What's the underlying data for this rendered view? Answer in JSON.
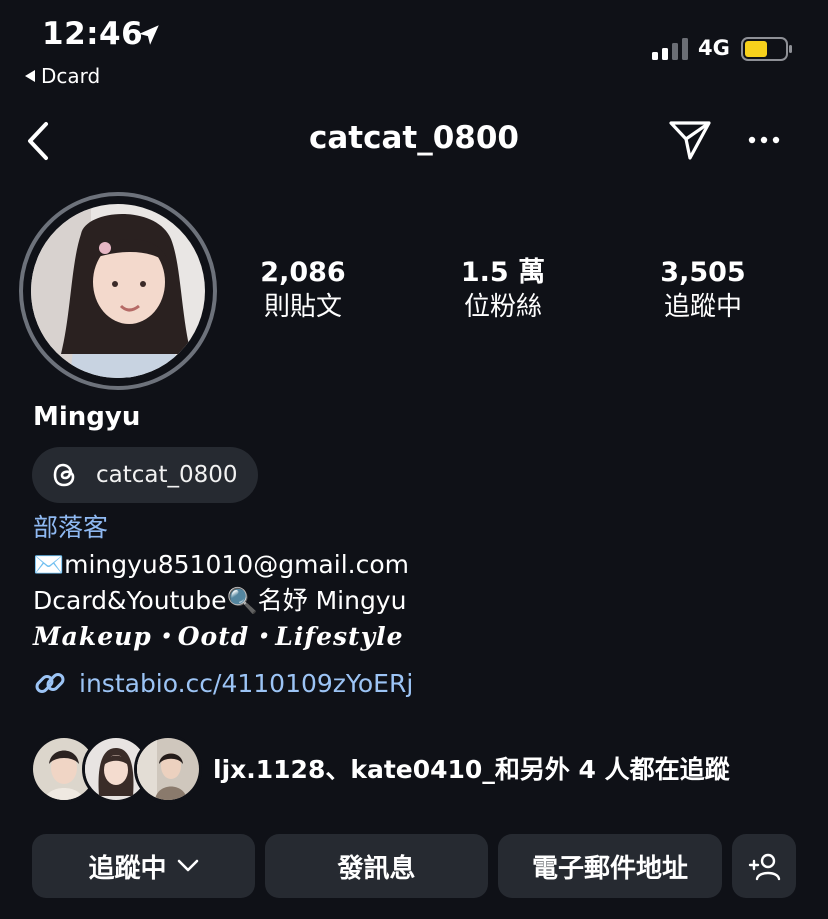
{
  "status_bar": {
    "time": "12:46",
    "back_app": "Dcard",
    "network": "4G",
    "battery_color": "#f7d11c"
  },
  "header": {
    "username": "catcat_0800",
    "icons": [
      "back-chevron-icon",
      "send-icon",
      "more-icon"
    ]
  },
  "profile": {
    "stats": [
      {
        "number": "2,086",
        "label": "則貼文"
      },
      {
        "number": "1.5 萬",
        "label": "位粉絲"
      },
      {
        "number": "3,505",
        "label": "追蹤中"
      }
    ],
    "display_name": "Mingyu",
    "threads_handle": "catcat_0800",
    "category": "部落客",
    "bio_lines": [
      "✉️mingyu851010@gmail.com",
      "Dcard&Youtube🔍名妤 Mingyu",
      "𝑴𝒂𝒌𝒆𝒖𝒑・𝑶𝒐𝒕𝒅・𝑳𝒊𝒇𝒆𝒔𝒕𝒚𝒍𝒆"
    ],
    "link": "instabio.cc/4110109zYoERj",
    "followed_by": "ljx.1128、kate0410_和另外 4 人都在追蹤"
  },
  "actions": {
    "follow": "追蹤中",
    "message": "發訊息",
    "email": "電子郵件地址"
  },
  "colors": {
    "background": "#0f1117",
    "button": "#262a31",
    "link": "#9cc4f5",
    "category": "#8fb9f2"
  }
}
